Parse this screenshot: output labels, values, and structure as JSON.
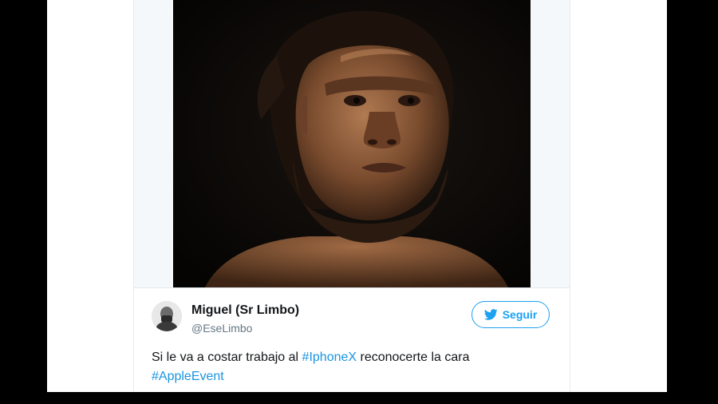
{
  "tweet": {
    "author_name": "Miguel (Sr Limbo)",
    "author_handle": "@EseLimbo",
    "follow_label": "Seguir",
    "text_part1": "Si le va a costar trabajo al ",
    "hashtag1": "#IphoneX",
    "text_part2": " reconocerte la cara",
    "hashtag2": "#AppleEvent"
  },
  "icons": {
    "follow": "twitter-bird-icon"
  },
  "colors": {
    "accent": "#1da1f2",
    "hashtag": "#1b95e0",
    "name_text": "#14171a",
    "handle_text": "#657786",
    "frame": "#000000"
  }
}
